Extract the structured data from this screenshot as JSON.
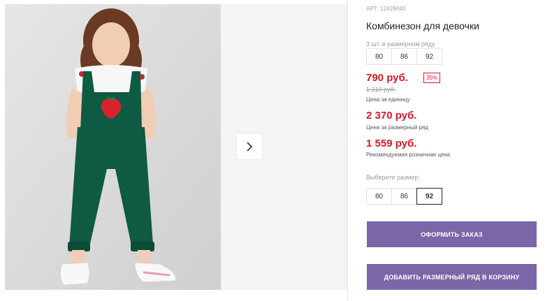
{
  "product": {
    "article": "АРТ. 12429040",
    "title": "Комбинезон для девочки",
    "pack_label": "3 шт. в размерном ряду",
    "pack_sizes": [
      "80",
      "86",
      "92"
    ],
    "price": "790 руб.",
    "discount": "35%",
    "old_price": "1 210 руб.",
    "unit_label": "Цена за единицу",
    "pack_price": "2 370 руб.",
    "pack_price_label": "Цена за размерный ряд",
    "rrp": "1 559 руб.",
    "rrp_label": "Рекомендуемая розничная цена",
    "choose_label": "Выберите размер:",
    "choose_sizes": [
      "80",
      "86",
      "92"
    ],
    "selected_size": "92"
  },
  "buttons": {
    "order": "ОФОРМИТЬ ЗАКАЗ",
    "add_pack": "ДОБАВИТЬ РАЗМЕРНЫЙ РЯД В КОРЗИНУ"
  },
  "gallery": {
    "next_icon": "chevron-right-icon"
  },
  "colors": {
    "price": "#d2182a",
    "accent_button": "#7b66a8",
    "overalls": "#0f5a43"
  }
}
